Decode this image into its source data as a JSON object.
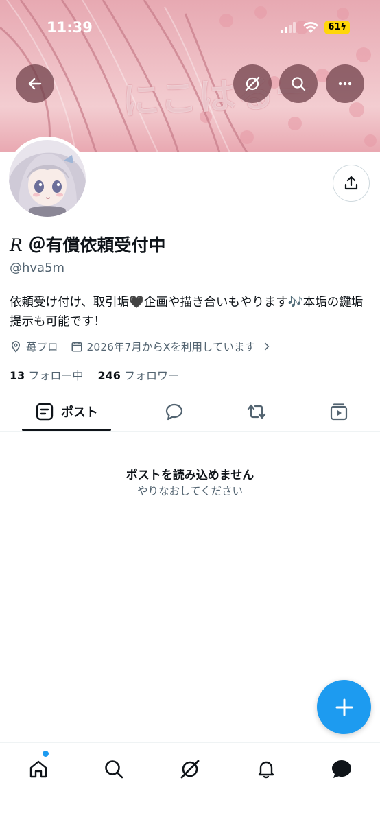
{
  "status_bar": {
    "time": "11:39",
    "battery": "61"
  },
  "banner": {
    "overlay_text": "にこはるー"
  },
  "profile": {
    "display_name_prefix": "R",
    "display_name": "＠有償依頼受付中",
    "handle": "@hva5m",
    "bio": "依頼受け付け、取引垢🖤企画や描き合いもやります🎶本垢の鍵垢提示も可能です！",
    "location": "苺プロ",
    "joined": "2026年7月からXを利用しています",
    "following_count": "13",
    "following_label": "フォロー中",
    "followers_count": "246",
    "followers_label": "フォロワー"
  },
  "tabs": [
    {
      "label": "ポスト",
      "icon": "posts-icon",
      "active": true
    },
    {
      "label": "",
      "icon": "replies-icon"
    },
    {
      "label": "",
      "icon": "reposts-icon"
    },
    {
      "label": "",
      "icon": "media-icon"
    }
  ],
  "empty_state": {
    "title": "ポストを読み込めません",
    "subtitle": "やりなおしてください"
  },
  "bottom_nav": [
    "home-icon",
    "search-icon",
    "grok-icon",
    "notifications-icon",
    "messages-icon"
  ],
  "colors": {
    "accent": "#1d9bf0",
    "text": "#0f1419",
    "secondary": "#536471"
  }
}
